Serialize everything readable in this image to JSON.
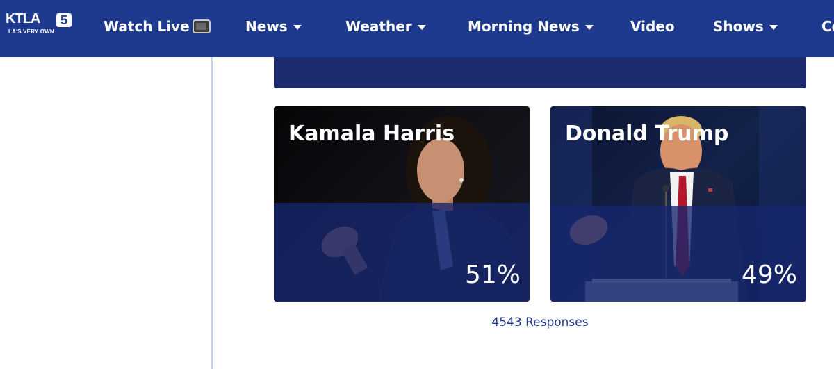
{
  "logo": {
    "main": "KTLA",
    "badge": "5",
    "tagline": "LA'S VERY OWN"
  },
  "nav": {
    "watch_live": "Watch Live",
    "news": "News",
    "weather": "Weather",
    "morning_news": "Morning News",
    "video": "Video",
    "shows": "Shows",
    "cut_off": "Co"
  },
  "icons": {
    "watch_live": "tv-icon",
    "dropdown": "caret-down-icon"
  },
  "colors": {
    "nav_bg": "#1e3a8f",
    "banner_bg": "#1c2a6e",
    "overlay": "#16266e",
    "responses_text": "#1e3a8f"
  },
  "poll": {
    "options": [
      {
        "name": "Kamala Harris",
        "percent": "51%",
        "share": 0.51
      },
      {
        "name": "Donald Trump",
        "percent": "49%",
        "share": 0.49
      }
    ],
    "responses": "4543 Responses"
  }
}
